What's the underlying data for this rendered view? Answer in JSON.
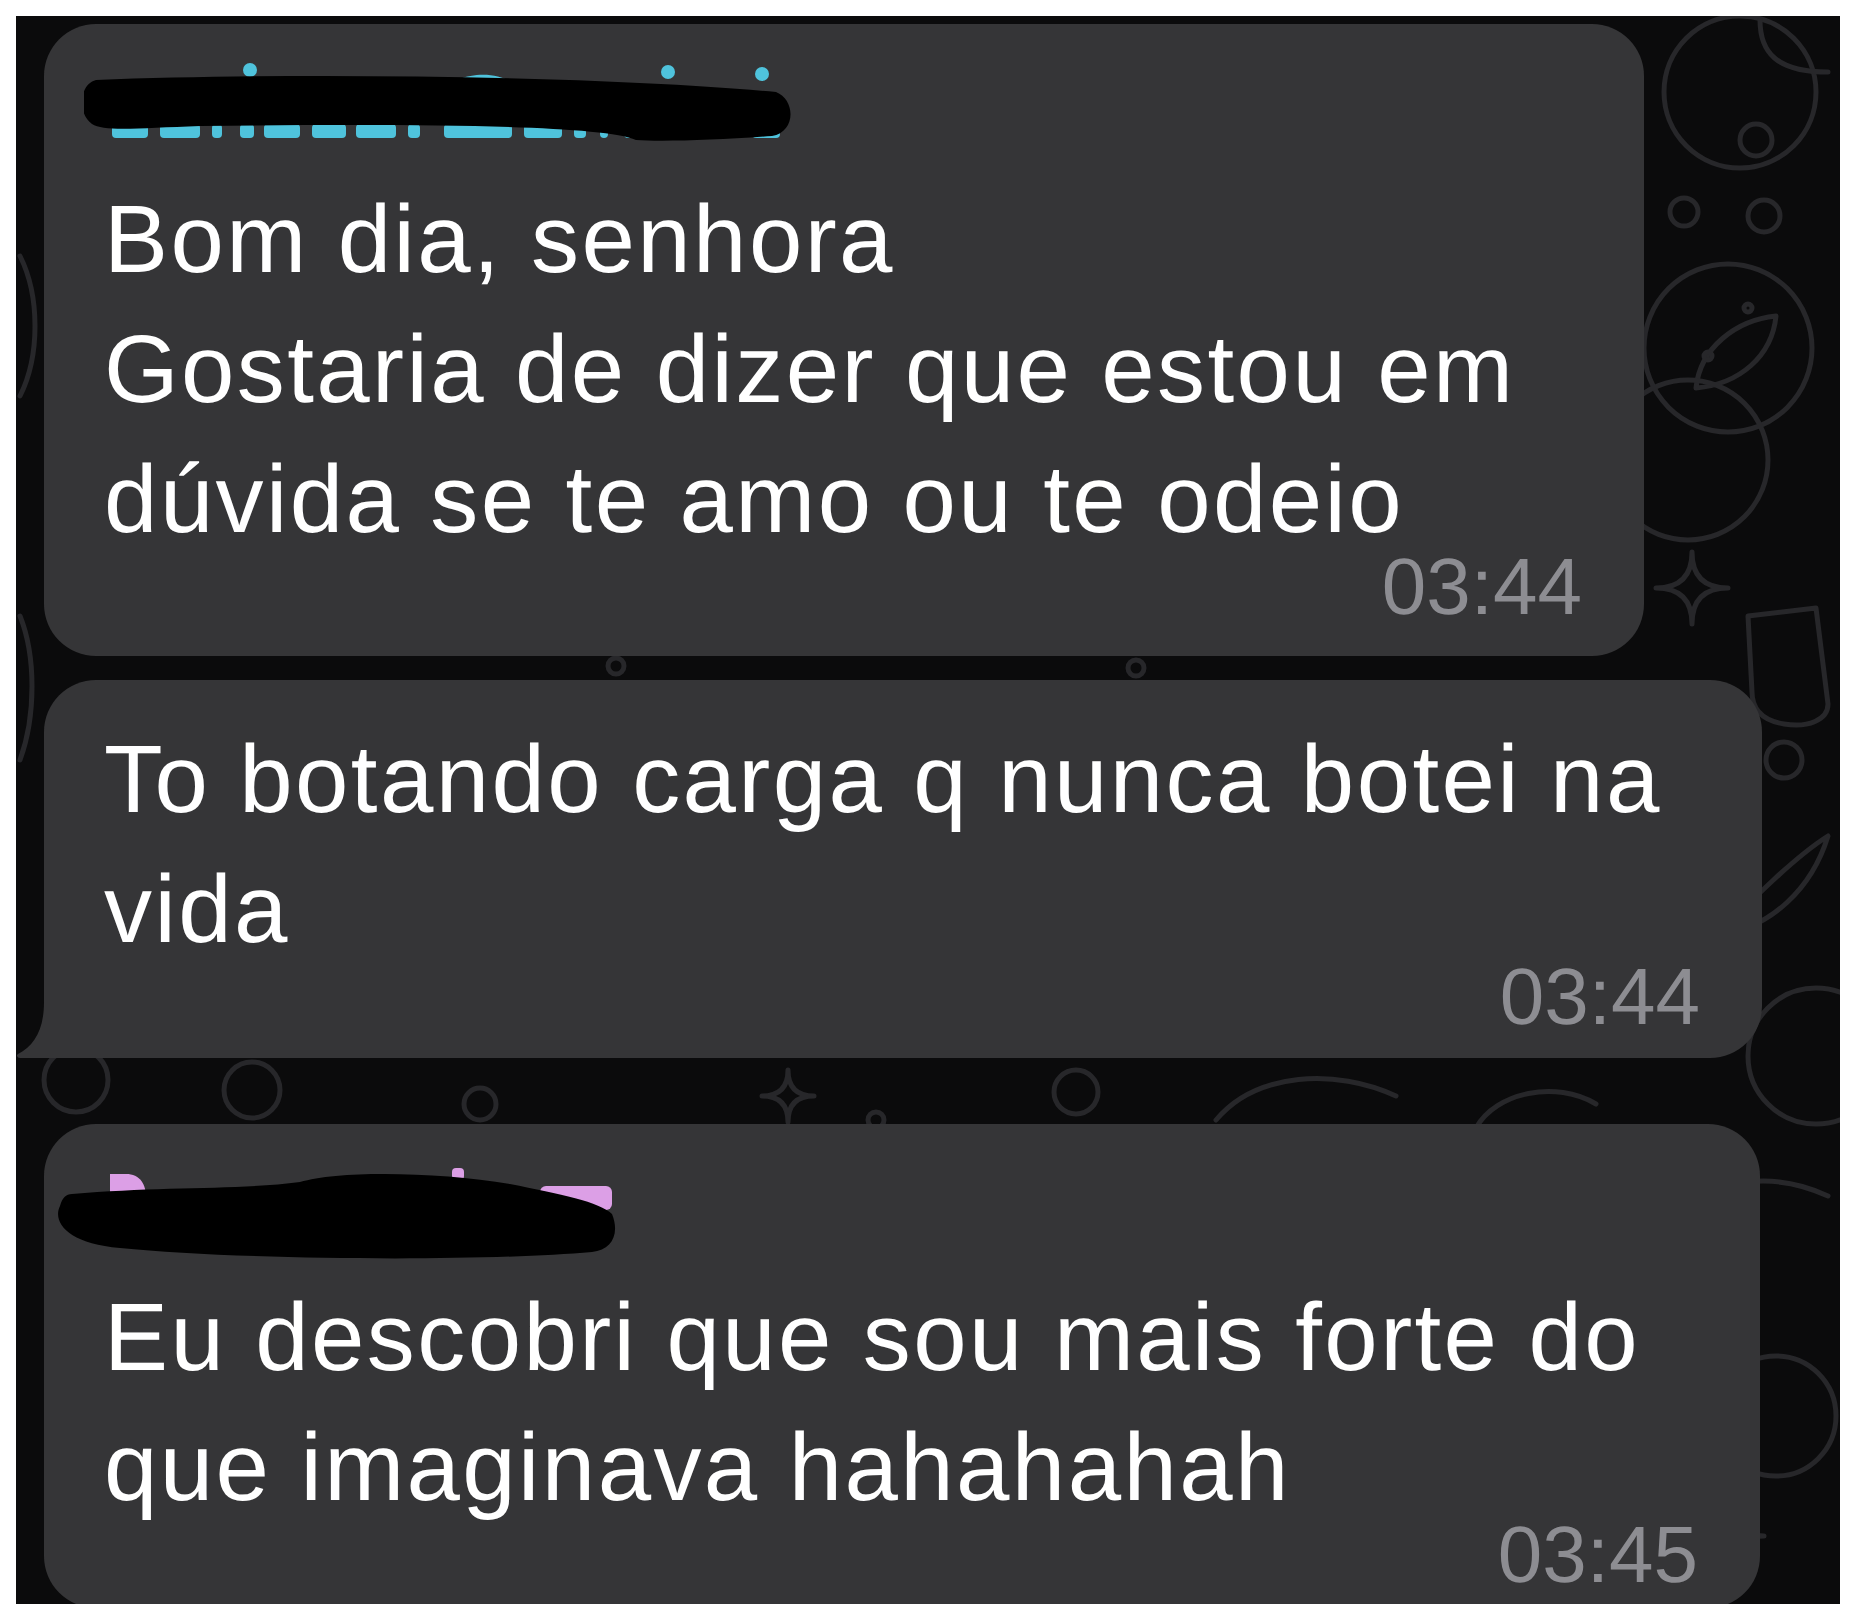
{
  "messages": [
    {
      "sender": {
        "redacted": true,
        "color": "#4fc3dc"
      },
      "text": "Bom dia, senhora\nGostaria de dizer que estou em dúvida se te amo ou te odeio",
      "time": "03:44",
      "tail": false
    },
    {
      "text": "To botando carga q nunca botei na vida",
      "time": "03:44",
      "tail": true
    },
    {
      "sender": {
        "redacted": true,
        "color": "#dc9fe6"
      },
      "text": "Eu descobri que sou mais forte do que imaginava hahahahah",
      "time": "03:45",
      "tail": false
    }
  ]
}
